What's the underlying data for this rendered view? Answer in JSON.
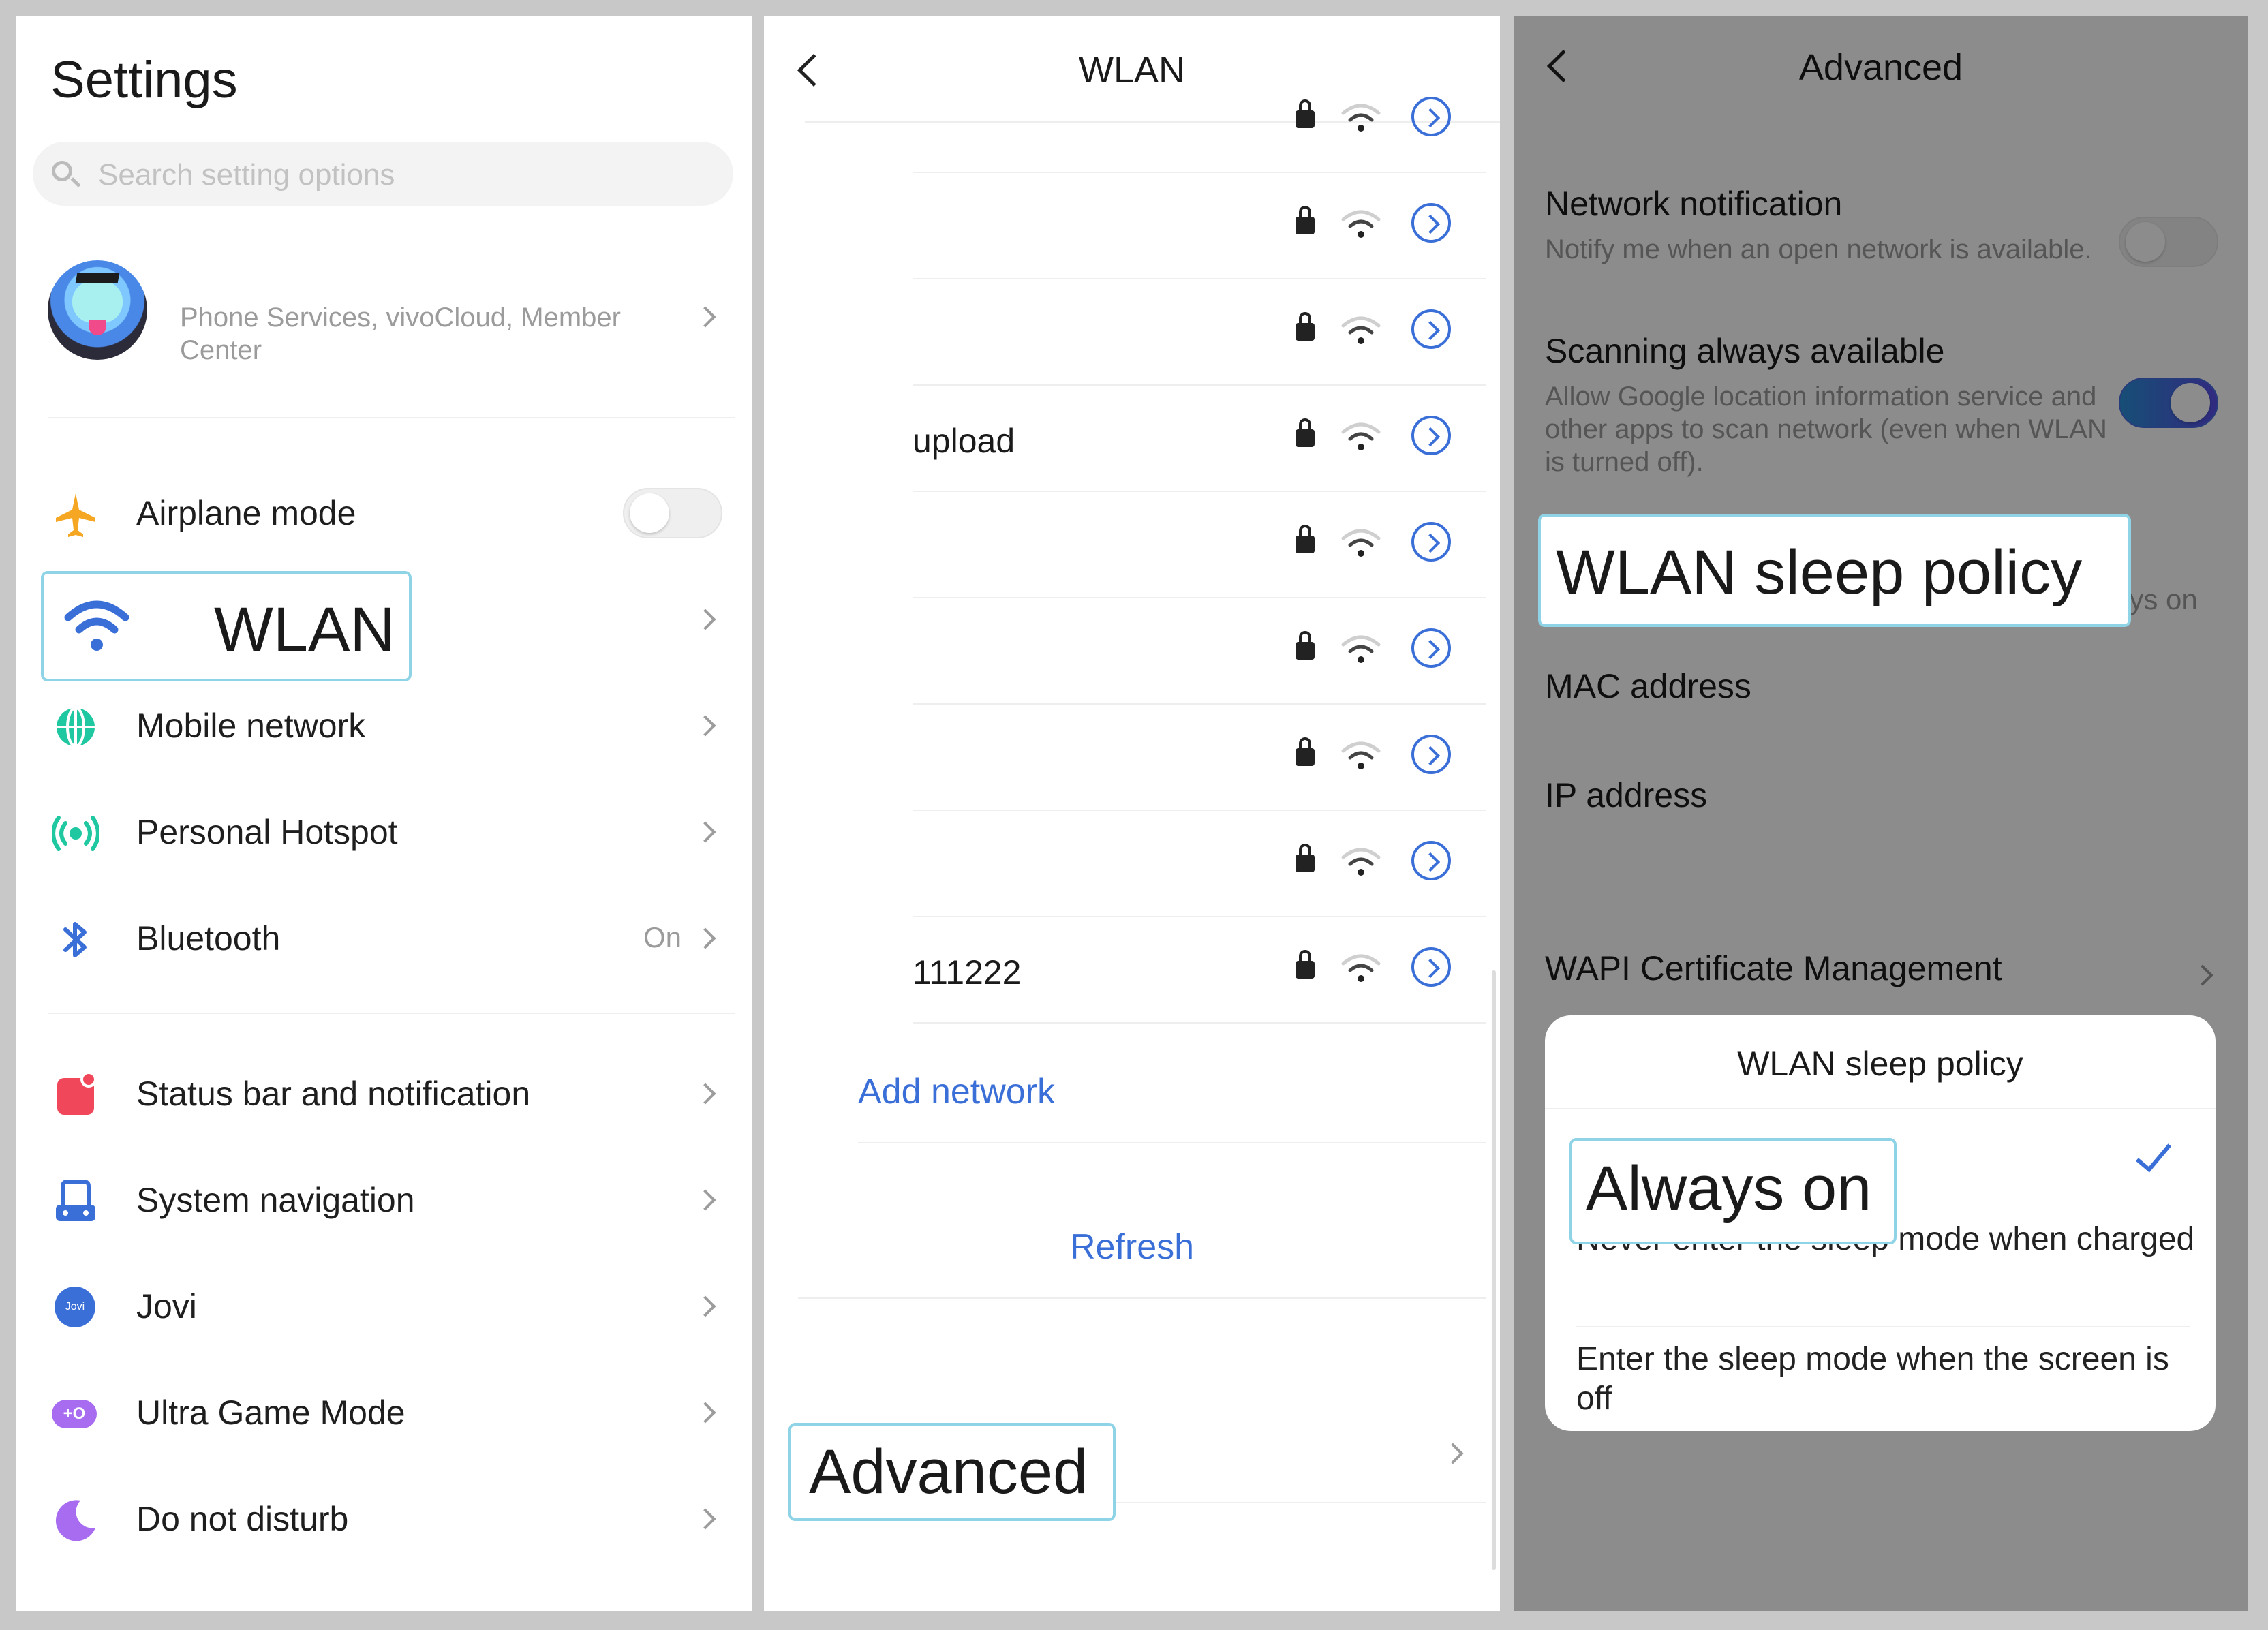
{
  "settings": {
    "title": "Settings",
    "search_placeholder": "Search setting options",
    "account_subtitle": "Phone Services, vivoCloud, Member Center",
    "items": [
      {
        "label": "Airplane mode"
      },
      {
        "label": "WLAN"
      },
      {
        "label": "Mobile network"
      },
      {
        "label": "Personal Hotspot"
      },
      {
        "label": "Bluetooth",
        "value": "On"
      },
      {
        "label": "Status bar and notification"
      },
      {
        "label": "System navigation"
      },
      {
        "label": "Jovi",
        "icon_text": "Jovi"
      },
      {
        "label": "Ultra Game Mode",
        "icon_text": "+O"
      },
      {
        "label": "Do not disturb"
      }
    ]
  },
  "wlan": {
    "title": "WLAN",
    "networks": [
      {
        "name": ""
      },
      {
        "name": ""
      },
      {
        "name": ""
      },
      {
        "name": "upload"
      },
      {
        "name": ""
      },
      {
        "name": ""
      },
      {
        "name": ""
      },
      {
        "name": ""
      },
      {
        "name": "111222"
      }
    ],
    "add_network": "Add network",
    "refresh": "Refresh",
    "advanced": "Advanced"
  },
  "advanced": {
    "title": "Advanced",
    "network_notification": {
      "title": "Network notification",
      "subtitle": "Notify me when an open network is available."
    },
    "scanning": {
      "title": "Scanning always available",
      "subtitle": "Allow Google location information service and other apps to scan network (even when WLAN is turned off)."
    },
    "sleep_policy": {
      "title": "WLAN sleep policy",
      "value_partial": "ays on"
    },
    "mac_address": "MAC address",
    "ip_address": "IP address",
    "wapi": "WAPI Certificate Management",
    "dialog": {
      "title": "WLAN sleep policy",
      "options": [
        {
          "title": "Always on",
          "subtitle": "Never enter the sleep mode when charged",
          "selected": true
        },
        {
          "title": "",
          "subtitle": "Enter the sleep mode when the screen is off",
          "selected": false
        }
      ]
    }
  },
  "colors": {
    "accent": "#3b6fd8",
    "highlight_border": "#8fd3e6",
    "airplane": "#f5a623",
    "wlan": "#3b6fd8",
    "mobile": "#1fc8a0",
    "hotspot": "#1fc8a0",
    "bluetooth": "#3b6fd8",
    "status_bar": "#f0475a",
    "system_nav": "#3b6fd8",
    "jovi": "#3b6fd8",
    "game": "#a86cf0",
    "dnd": "#a86cf0"
  }
}
